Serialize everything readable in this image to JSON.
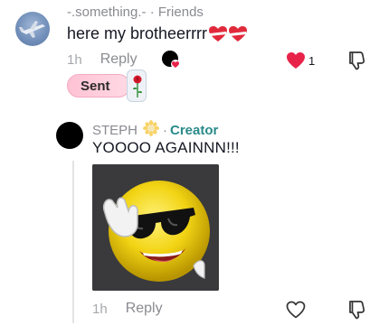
{
  "comment": {
    "username": "-.something.-",
    "separator": " · ",
    "relation": "Friends",
    "text": "here my brotheerrrr",
    "time": "1h",
    "reply_label": "Reply",
    "like_count": "1",
    "sent_label": "Sent"
  },
  "reply_comment": {
    "username": "STEPH",
    "separator": "·",
    "badge": "Creator",
    "text": "YOOOO AGAINNN!!!",
    "time": "1h",
    "reply_label": "Reply"
  },
  "colors": {
    "like_active": "#e8234a",
    "creator_badge": "#2a8a8a",
    "sent_pill": "#ffc2d4",
    "muted_text": "#8a8b91"
  },
  "icons": {
    "like": "heart-filled-icon",
    "like_empty": "heart-outline-icon",
    "dislike": "thumbs-down-icon",
    "gift": "rose-gift-icon"
  }
}
